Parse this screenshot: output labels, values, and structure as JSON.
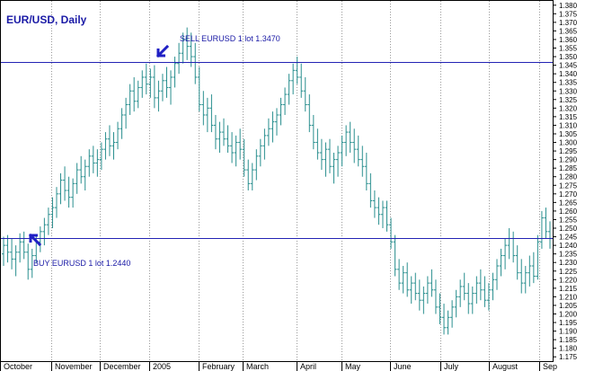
{
  "chart_data": {
    "type": "ohlc",
    "title": "EUR/USD, Daily",
    "ylim": [
      1.1725,
      1.3825
    ],
    "grid": "vertical-dotted",
    "y_ticks": [
      "1.380",
      "1.375",
      "1.370",
      "1.365",
      "1.360",
      "1.355",
      "1.350",
      "1.345",
      "1.340",
      "1.335",
      "1.330",
      "1.325",
      "1.320",
      "1.315",
      "1.310",
      "1.305",
      "1.300",
      "1.295",
      "1.290",
      "1.285",
      "1.280",
      "1.275",
      "1.270",
      "1.265",
      "1.260",
      "1.255",
      "1.250",
      "1.245",
      "1.240",
      "1.235",
      "1.230",
      "1.225",
      "1.220",
      "1.215",
      "1.210",
      "1.205",
      "1.200",
      "1.195",
      "1.190",
      "1.185",
      "1.180",
      "1.175"
    ],
    "x_ticks": [
      "October",
      "November",
      "December",
      "2005",
      "February",
      "March",
      "April",
      "May",
      "June",
      "July",
      "August",
      "Sep"
    ],
    "horizontal_lines": [
      1.347,
      1.244
    ],
    "annotations": [
      {
        "text": "SELL EURUSD 1 lot 1.3470",
        "price": 1.347,
        "arrow": "down-left"
      },
      {
        "text": "BUY EURUSD 1 lot 1.2440",
        "price": 1.244,
        "arrow": "up-left"
      }
    ],
    "colors": {
      "bars": "#2a8f8f",
      "lines": "#2323b4",
      "text": "#1a1aa6",
      "grid": "#9a9a9a"
    },
    "series": [
      {
        "ohlc": [
          [
            1.235,
            1.245,
            1.228,
            1.24
          ],
          [
            1.24,
            1.246,
            1.23,
            1.236
          ],
          [
            1.236,
            1.244,
            1.226,
            1.232
          ],
          [
            1.232,
            1.24,
            1.222,
            1.236
          ],
          [
            1.236,
            1.247,
            1.23,
            1.242
          ],
          [
            1.242,
            1.248,
            1.232,
            1.236
          ],
          [
            1.236,
            1.241,
            1.22,
            1.226
          ],
          [
            1.226,
            1.238,
            1.221,
            1.234
          ],
          [
            1.234,
            1.246,
            1.23,
            1.242
          ],
          [
            1.242,
            1.251,
            1.236,
            1.248
          ],
          [
            1.248,
            1.256,
            1.24,
            1.252
          ],
          [
            1.252,
            1.262,
            1.246,
            1.258
          ],
          [
            1.258,
            1.268,
            1.25,
            1.262
          ],
          [
            1.262,
            1.274,
            1.256,
            1.27
          ],
          [
            1.27,
            1.282,
            1.264,
            1.278
          ],
          [
            1.278,
            1.286,
            1.266,
            1.272
          ],
          [
            1.272,
            1.28,
            1.262,
            1.268
          ],
          [
            1.268,
            1.279,
            1.262,
            1.276
          ],
          [
            1.276,
            1.288,
            1.27,
            1.284
          ],
          [
            1.284,
            1.292,
            1.276,
            1.28
          ],
          [
            1.28,
            1.29,
            1.272,
            1.286
          ],
          [
            1.286,
            1.296,
            1.28,
            1.292
          ],
          [
            1.292,
            1.298,
            1.282,
            1.288
          ],
          [
            1.288,
            1.296,
            1.28,
            1.29
          ],
          [
            1.29,
            1.3,
            1.284,
            1.296
          ],
          [
            1.296,
            1.306,
            1.29,
            1.302
          ],
          [
            1.302,
            1.31,
            1.292,
            1.298
          ],
          [
            1.298,
            1.306,
            1.29,
            1.3
          ],
          [
            1.3,
            1.312,
            1.296,
            1.308
          ],
          [
            1.308,
            1.32,
            1.302,
            1.316
          ],
          [
            1.316,
            1.326,
            1.308,
            1.322
          ],
          [
            1.322,
            1.334,
            1.316,
            1.33
          ],
          [
            1.33,
            1.338,
            1.318,
            1.324
          ],
          [
            1.324,
            1.336,
            1.32,
            1.332
          ],
          [
            1.332,
            1.342,
            1.326,
            1.338
          ],
          [
            1.338,
            1.346,
            1.328,
            1.334
          ],
          [
            1.334,
            1.343,
            1.326,
            1.338
          ],
          [
            1.338,
            1.345,
            1.32,
            1.326
          ],
          [
            1.326,
            1.336,
            1.318,
            1.33
          ],
          [
            1.33,
            1.34,
            1.324,
            1.336
          ],
          [
            1.336,
            1.344,
            1.326,
            1.332
          ],
          [
            1.332,
            1.342,
            1.322,
            1.338
          ],
          [
            1.338,
            1.35,
            1.332,
            1.346
          ],
          [
            1.346,
            1.358,
            1.34,
            1.352
          ],
          [
            1.352,
            1.364,
            1.346,
            1.36
          ],
          [
            1.36,
            1.367,
            1.348,
            1.356
          ],
          [
            1.356,
            1.364,
            1.344,
            1.35
          ],
          [
            1.35,
            1.358,
            1.334,
            1.338
          ],
          [
            1.338,
            1.344,
            1.318,
            1.322
          ],
          [
            1.322,
            1.33,
            1.31,
            1.316
          ],
          [
            1.316,
            1.326,
            1.306,
            1.32
          ],
          [
            1.32,
            1.328,
            1.306,
            1.31
          ],
          [
            1.31,
            1.316,
            1.296,
            1.302
          ],
          [
            1.302,
            1.312,
            1.294,
            1.306
          ],
          [
            1.306,
            1.314,
            1.298,
            1.302
          ],
          [
            1.302,
            1.31,
            1.294,
            1.298
          ],
          [
            1.298,
            1.306,
            1.288,
            1.294
          ],
          [
            1.294,
            1.304,
            1.286,
            1.3
          ],
          [
            1.3,
            1.308,
            1.29,
            1.296
          ],
          [
            1.296,
            1.302,
            1.28,
            1.284
          ],
          [
            1.284,
            1.29,
            1.272,
            1.276
          ],
          [
            1.276,
            1.288,
            1.272,
            1.284
          ],
          [
            1.284,
            1.296,
            1.278,
            1.292
          ],
          [
            1.292,
            1.302,
            1.286,
            1.298
          ],
          [
            1.298,
            1.308,
            1.29,
            1.304
          ],
          [
            1.304,
            1.314,
            1.298,
            1.308
          ],
          [
            1.308,
            1.318,
            1.3,
            1.312
          ],
          [
            1.312,
            1.32,
            1.304,
            1.316
          ],
          [
            1.316,
            1.326,
            1.31,
            1.322
          ],
          [
            1.322,
            1.332,
            1.316,
            1.328
          ],
          [
            1.328,
            1.34,
            1.322,
            1.336
          ],
          [
            1.336,
            1.346,
            1.328,
            1.342
          ],
          [
            1.342,
            1.35,
            1.334,
            1.338
          ],
          [
            1.338,
            1.346,
            1.326,
            1.33
          ],
          [
            1.33,
            1.338,
            1.318,
            1.322
          ],
          [
            1.322,
            1.328,
            1.306,
            1.31
          ],
          [
            1.31,
            1.316,
            1.296,
            1.3
          ],
          [
            1.3,
            1.308,
            1.29,
            1.294
          ],
          [
            1.294,
            1.302,
            1.284,
            1.29
          ],
          [
            1.29,
            1.3,
            1.28,
            1.296
          ],
          [
            1.296,
            1.302,
            1.282,
            1.286
          ],
          [
            1.286,
            1.294,
            1.276,
            1.29
          ],
          [
            1.29,
            1.298,
            1.28,
            1.294
          ],
          [
            1.294,
            1.304,
            1.286,
            1.3
          ],
          [
            1.3,
            1.31,
            1.292,
            1.306
          ],
          [
            1.306,
            1.312,
            1.294,
            1.3
          ],
          [
            1.3,
            1.308,
            1.288,
            1.296
          ],
          [
            1.296,
            1.304,
            1.286,
            1.29
          ],
          [
            1.29,
            1.298,
            1.28,
            1.286
          ],
          [
            1.286,
            1.294,
            1.272,
            1.276
          ],
          [
            1.276,
            1.282,
            1.262,
            1.266
          ],
          [
            1.266,
            1.272,
            1.256,
            1.262
          ],
          [
            1.262,
            1.268,
            1.252,
            1.258
          ],
          [
            1.258,
            1.266,
            1.25,
            1.262
          ],
          [
            1.262,
            1.266,
            1.248,
            1.252
          ],
          [
            1.252,
            1.256,
            1.238,
            1.242
          ],
          [
            1.242,
            1.246,
            1.222,
            1.226
          ],
          [
            1.226,
            1.232,
            1.214,
            1.218
          ],
          [
            1.218,
            1.228,
            1.212,
            1.224
          ],
          [
            1.224,
            1.23,
            1.21,
            1.214
          ],
          [
            1.214,
            1.222,
            1.206,
            1.218
          ],
          [
            1.218,
            1.224,
            1.208,
            1.212
          ],
          [
            1.212,
            1.22,
            1.202,
            1.208
          ],
          [
            1.208,
            1.216,
            1.2,
            1.212
          ],
          [
            1.212,
            1.222,
            1.206,
            1.218
          ],
          [
            1.218,
            1.226,
            1.21,
            1.214
          ],
          [
            1.214,
            1.22,
            1.2,
            1.204
          ],
          [
            1.204,
            1.212,
            1.194,
            1.198
          ],
          [
            1.198,
            1.206,
            1.188,
            1.192
          ],
          [
            1.192,
            1.202,
            1.188,
            1.198
          ],
          [
            1.198,
            1.208,
            1.192,
            1.204
          ],
          [
            1.204,
            1.214,
            1.198,
            1.21
          ],
          [
            1.21,
            1.22,
            1.204,
            1.216
          ],
          [
            1.216,
            1.224,
            1.208,
            1.212
          ],
          [
            1.212,
            1.218,
            1.2,
            1.206
          ],
          [
            1.206,
            1.216,
            1.2,
            1.212
          ],
          [
            1.212,
            1.222,
            1.206,
            1.218
          ],
          [
            1.218,
            1.226,
            1.208,
            1.214
          ],
          [
            1.214,
            1.222,
            1.204,
            1.208
          ],
          [
            1.208,
            1.218,
            1.202,
            1.214
          ],
          [
            1.214,
            1.224,
            1.208,
            1.22
          ],
          [
            1.22,
            1.232,
            1.214,
            1.228
          ],
          [
            1.228,
            1.238,
            1.222,
            1.234
          ],
          [
            1.234,
            1.244,
            1.226,
            1.24
          ],
          [
            1.24,
            1.25,
            1.232,
            1.244
          ],
          [
            1.244,
            1.248,
            1.23,
            1.234
          ],
          [
            1.234,
            1.24,
            1.22,
            1.224
          ],
          [
            1.224,
            1.232,
            1.212,
            1.218
          ],
          [
            1.218,
            1.228,
            1.212,
            1.224
          ],
          [
            1.224,
            1.234,
            1.216,
            1.228
          ],
          [
            1.228,
            1.236,
            1.218,
            1.222
          ],
          [
            1.222,
            1.246,
            1.22,
            1.242
          ],
          [
            1.242,
            1.26,
            1.238,
            1.256
          ],
          [
            1.256,
            1.262,
            1.244,
            1.248
          ],
          [
            1.248,
            1.254,
            1.238,
            1.244
          ]
        ]
      }
    ]
  }
}
